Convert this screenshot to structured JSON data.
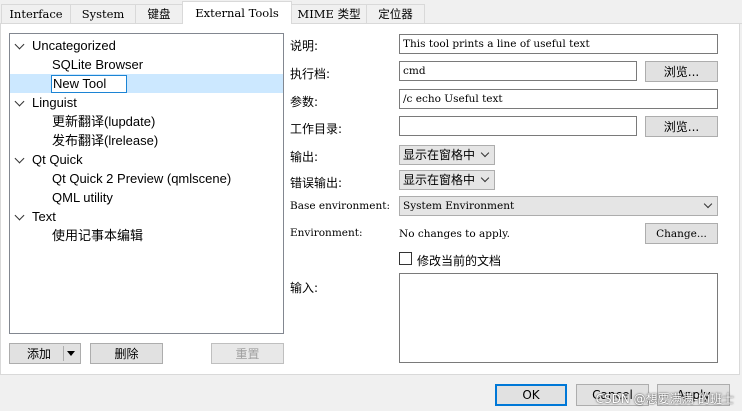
{
  "tabs": [
    "Interface",
    "System",
    "键盘",
    "External Tools",
    "MIME 类型",
    "定位器"
  ],
  "active_tab": "External Tools",
  "tree": {
    "categories": [
      {
        "label": "Uncategorized",
        "tools": [
          "SQLite Browser",
          "New Tool"
        ]
      },
      {
        "label": "Linguist",
        "tools": [
          "更新翻译(lupdate)",
          "发布翻译(lrelease)"
        ]
      },
      {
        "label": "Qt Quick",
        "tools": [
          "Qt Quick 2 Preview (qmlscene)",
          "QML utility"
        ]
      },
      {
        "label": "Text",
        "tools": [
          "使用记事本编辑"
        ]
      }
    ],
    "selected_tool": "New Tool"
  },
  "tree_buttons": {
    "add": "添加",
    "remove": "删除",
    "reset": "重置"
  },
  "form": {
    "description_label": "说明:",
    "description_value": "This tool prints a line of useful text",
    "executable_label": "执行档:",
    "executable_value": "cmd",
    "browse_label": "浏览...",
    "arguments_label": "参数:",
    "arguments_value": "/c echo Useful text",
    "workdir_label": "工作目录:",
    "workdir_value": "",
    "browse2_label": "浏览...",
    "output_label": "输出:",
    "output_value": "显示在窗格中",
    "error_output_label": "错误输出:",
    "error_output_value": "显示在窗格中",
    "base_env_label": "Base environment:",
    "base_env_value": "System Environment",
    "env_label": "Environment:",
    "env_value": "No changes to apply.",
    "change_label": "Change...",
    "modify_doc_label": "修改当前的文档",
    "modify_doc_checked": false,
    "input_label": "输入:",
    "input_value": ""
  },
  "dialog_buttons": {
    "ok": "OK",
    "cancel": "Cancel",
    "apply": "Apply"
  },
  "watermark": "CSDN @想要满满-的班士"
}
